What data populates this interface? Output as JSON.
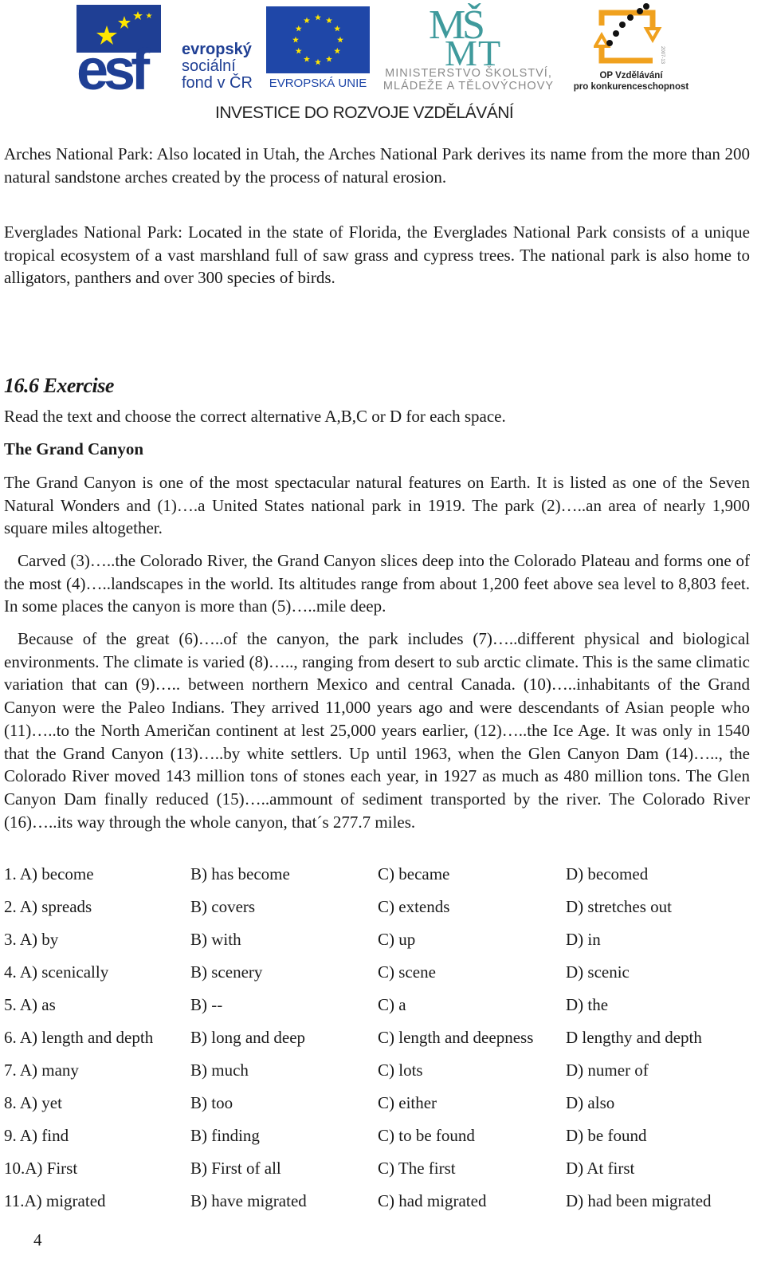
{
  "header": {
    "esf_line1": "evropský",
    "esf_line2": "sociální",
    "esf_line3": "fond v ČR",
    "eu_label": "EVROPSKÁ UNIE",
    "msmt_line1": "MINISTERSTVO ŠKOLSTVÍ,",
    "msmt_line2": "MLÁDEŽE A TĚLOVÝCHOVY",
    "op_line1": "OP Vzdělávání",
    "op_line2": "pro konkurenceschopnost",
    "tagline": "INVESTICE DO ROZVOJE VZDĚLÁVÁNÍ",
    "colors": {
      "esf_blue": "#1f3f94",
      "eu_blue": "#1f47a8",
      "star_yellow": "#ffe600",
      "msmt_teal": "#3f9a9c",
      "op_orange": "#f0a11e"
    }
  },
  "intro": {
    "arches": "Arches National Park: Also located in Utah, the Arches National Park derives its name from the more than 200 natural sandstone arches created by the process of natural erosion.",
    "everglades": "Everglades National Park: Located in the state of Florida, the Everglades National Park consists of a unique tropical ecosystem of a vast marshland full of saw grass and cypress trees. The national park is also home to alligators, panthers and over 300 species of birds."
  },
  "exercise": {
    "heading": "16.6  Exercise",
    "instruction": "Read the text and choose the correct alternative A,B,C or D for each space.",
    "title": "The Grand Canyon",
    "paragraphs": [
      "The Grand Canyon is one of the most spectacular natural features on Earth. It is listed as one of the Seven Natural Wonders and  (1)….a United States national park in 1919. The park (2)…..an area of nearly 1,900 square miles altogether.",
      "Carved (3)…..the Colorado River, the Grand Canyon slices deep into the Colorado Plateau and forms one of the most (4)…..landscapes in the world. Its altitudes range from about 1,200 feet above sea level to 8,803 feet. In some places the canyon is more than (5)…..mile deep.",
      "Because of the great (6)…..of the canyon, the park includes (7)…..different physical and biological environments. The climate is varied (8)….., ranging from desert to sub arctic climate. This is the same climatic variation that can (9)….. between northern Mexico and central Canada. (10)…..inhabitants of the Grand Canyon were the Paleo Indians. They arrived 11,000 years ago and were descendants of Asian people who (11)…..to the North Američan continent at lest 25,000 years earlier, (12)…..the Ice Age. It was only in 1540 that the Grand Canyon (13)…..by white settlers. Up until 1963, when the Glen Canyon Dam (14)….., the Colorado River moved 143 million tons of stones each year, in 1927 as much as 480 million tons. The Glen Canyon Dam finally reduced (15)…..ammount of sediment transported by the river. The Colorado River (16)…..its way through the whole canyon, that´s 277.7 miles."
    ],
    "options": [
      [
        "1. A) become",
        "B) has become",
        "C) became",
        "D) becomed"
      ],
      [
        "2. A) spreads",
        "B) covers",
        "C) extends",
        "D) stretches out"
      ],
      [
        "3. A) by",
        "B) with",
        "C) up",
        "D) in"
      ],
      [
        "4. A) scenically",
        "B) scenery",
        "C) scene",
        "D) scenic"
      ],
      [
        "5. A) as",
        "B) --",
        "C) a",
        "D) the"
      ],
      [
        "6. A) length and depth",
        "B) long and deep",
        "C) length and deepness",
        "D  lengthy and depth"
      ],
      [
        "7. A) many",
        "B) much",
        "C) lots",
        "D) numer of"
      ],
      [
        "8. A) yet",
        "B) too",
        "C) either",
        "D) also"
      ],
      [
        "9. A) find",
        "B) finding",
        "C) to be found",
        "D) be found"
      ],
      [
        "10.A) First",
        "B) First of all",
        "C) The first",
        "D) At first"
      ],
      [
        "11.A) migrated",
        "B) have migrated",
        "C) had migrated",
        "D) had been migrated"
      ]
    ]
  },
  "footer": {
    "page_number": "4"
  }
}
